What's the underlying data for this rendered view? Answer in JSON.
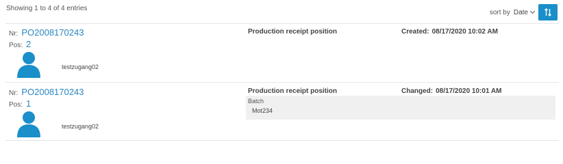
{
  "header": {
    "showing_text": "Showing 1 to 4 of 4 entries",
    "sort_label": "sort by",
    "sort_value": "Date",
    "sort_button_icon": "sort-order-icon"
  },
  "entries": [
    {
      "nr_label": "Nr:",
      "nr": "PO2008170243",
      "pos_label": "Pos:",
      "pos": "2",
      "user": "testzugang02",
      "type": "Production receipt position",
      "stamp_label": "Created:",
      "stamp_date": "08/17/2020 10:02 AM"
    },
    {
      "nr_label": "Nr:",
      "nr": "PO2008170243",
      "pos_label": "Pos:",
      "pos": "1",
      "user": "testzugang02",
      "type": "Production receipt position",
      "stamp_label": "Changed:",
      "stamp_date": "08/17/2020 10:01 AM",
      "batch_label": "Batch",
      "batch_value": "Mot234"
    }
  ],
  "colors": {
    "accent": "#1a8fc9",
    "link": "#2a86c2",
    "avatar": "#1a8fc9",
    "batch_bg": "#f0f0f0"
  }
}
